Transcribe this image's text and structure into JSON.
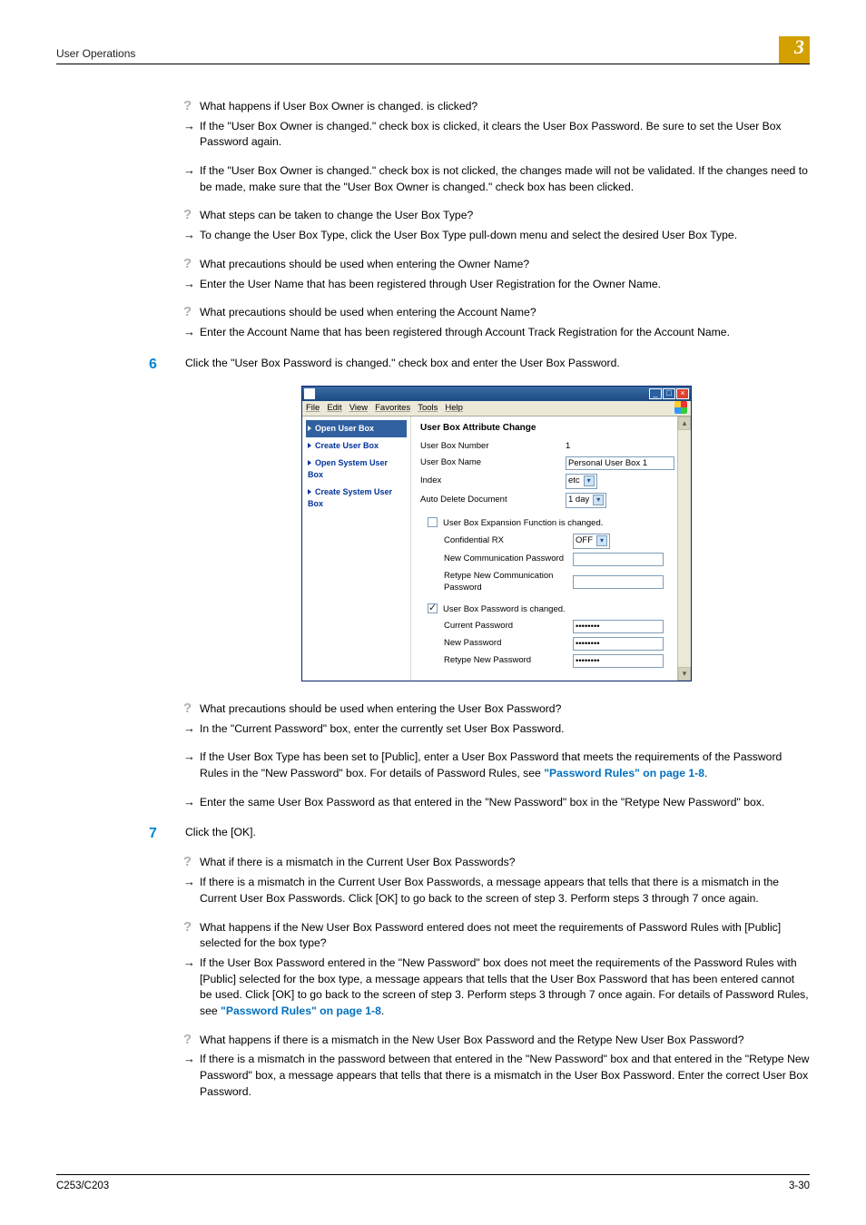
{
  "header": {
    "section": "User Operations",
    "chapter": "3"
  },
  "qa": {
    "q1": "What happens if User Box Owner is changed. is clicked?",
    "a1a": "If the \"User Box Owner is changed.\" check box is clicked, it clears the User Box Password. Be sure to set the User Box Password again.",
    "a1b": "If the \"User Box Owner is changed.\" check box is not clicked, the changes made will not be validated. If the changes need to be made, make sure that the \"User Box Owner is changed.\" check box has been clicked.",
    "q2": "What steps can be taken to change the User Box Type?",
    "a2": "To change the User Box Type, click the User Box Type pull-down menu and select the desired User Box Type.",
    "q3": "What precautions should be used when entering the Owner Name?",
    "a3": "Enter the User Name that has been registered through User Registration for the Owner Name.",
    "q4": "What precautions should be used when entering the Account Name?",
    "a4": "Enter the Account Name that has been registered through Account Track Registration for the Account Name."
  },
  "steps": {
    "s6_num": "6",
    "s6_text": "Click the \"User Box Password is changed.\" check box and enter the User Box Password.",
    "s7_num": "7",
    "s7_text": "Click the [OK]."
  },
  "qa2": {
    "q1": "What precautions should be used when entering the User Box Password?",
    "a1": "In the \"Current Password\" box, enter the currently set User Box Password.",
    "a2_pre": "If the User Box Type has been set to [Public], enter a User Box Password that meets the requirements of the Password Rules in the \"New Password\" box. For details of Password Rules, see ",
    "a2_link": "\"Password Rules\" on page 1-8",
    "a2_post": ".",
    "a3": "Enter the same User Box Password as that entered in the \"New Password\" box in the \"Retype New Password\" box."
  },
  "qa3": {
    "q1": "What if there is a mismatch in the Current User Box Passwords?",
    "a1": "If there is a mismatch in the Current User Box Passwords, a message appears that tells that there is a mismatch in the Current User Box Passwords. Click [OK] to go back to the screen of step 3. Perform steps 3 through 7 once again.",
    "q2": "What happens if the New User Box Password entered does not meet the requirements of Password Rules with [Public] selected for the box type?",
    "a2_pre": "If the User Box Password entered in the \"New Password\" box does not meet the requirements of the Password Rules with [Public] selected for the box type, a message appears that tells that the User Box Password that has been entered cannot be used. Click [OK] to go back to the screen of step 3. Perform steps 3 through 7 once again. For details of Password Rules, see ",
    "a2_link": "\"Password Rules\" on page 1-8",
    "a2_post": ".",
    "q3": "What happens if there is a mismatch in the New User Box Password and the Retype New User Box Password?",
    "a3": "If there is a mismatch in the password between that entered in the \"New Password\" box and that entered in the \"Retype New Password\" box, a message appears that tells that there is a mismatch in the User Box Password. Enter the correct User Box Password."
  },
  "screenshot": {
    "menu": {
      "file": "File",
      "edit": "Edit",
      "view": "View",
      "favorites": "Favorites",
      "tools": "Tools",
      "help": "Help"
    },
    "nav": {
      "open_user_box": "Open User Box",
      "create_user_box": "Create User Box",
      "open_system_user_box": "Open System User Box",
      "create_system_user_box": "Create System User Box"
    },
    "main": {
      "title": "User Box Attribute Change",
      "number_label": "User Box Number",
      "number_value": "1",
      "name_label": "User Box Name",
      "name_value": "Personal User Box 1",
      "index_label": "Index",
      "index_value": "etc",
      "autodel_label": "Auto Delete Document",
      "autodel_value": "1 day",
      "exp_check": "User Box Expansion Function is changed.",
      "conf_rx_label": "Confidential RX",
      "conf_rx_value": "OFF",
      "new_comm_pw": "New Communication Password",
      "retype_comm_pw": "Retype New Communication Password",
      "pw_check": "User Box Password is changed.",
      "cur_pw": "Current Password",
      "new_pw": "New Password",
      "retype_pw": "Retype New Password",
      "mask": "••••••••"
    }
  },
  "footer": {
    "left": "C253/C203",
    "right": "3-30"
  }
}
